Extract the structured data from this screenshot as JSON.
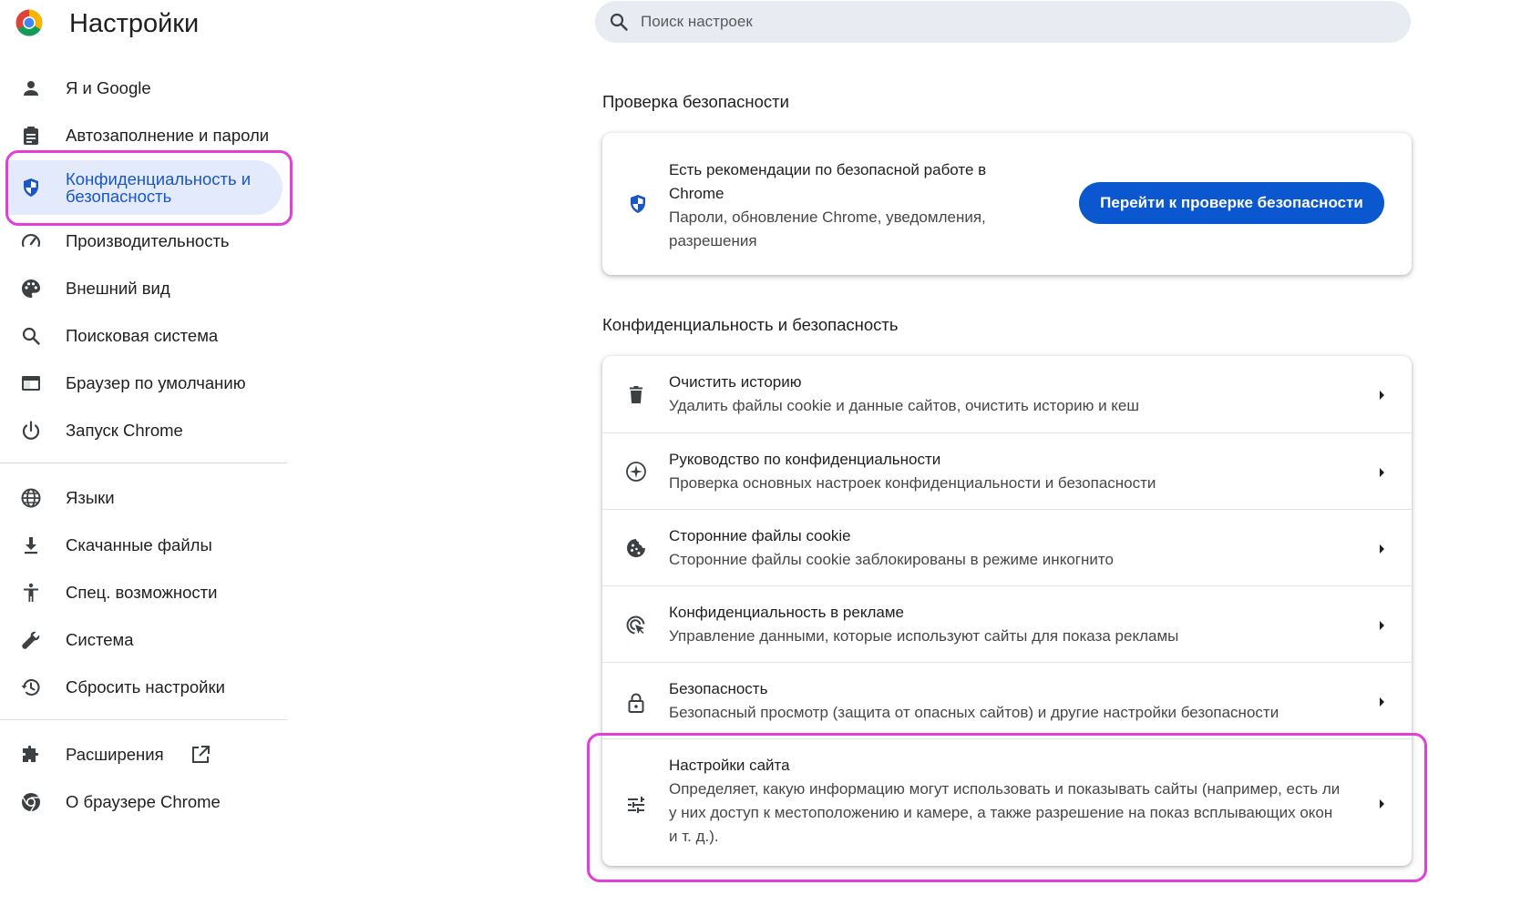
{
  "header": {
    "title": "Настройки",
    "search_placeholder": "Поиск настроек"
  },
  "sidebar": {
    "items": [
      {
        "label": "Я и Google",
        "icon": "person-icon"
      },
      {
        "label": "Автозаполнение и пароли",
        "icon": "clipboard-icon"
      },
      {
        "label": "Конфиденциальность и безопасность",
        "icon": "shield-icon",
        "active": true
      },
      {
        "label": "Производительность",
        "icon": "speedometer-icon"
      },
      {
        "label": "Внешний вид",
        "icon": "palette-icon"
      },
      {
        "label": "Поисковая система",
        "icon": "search-icon"
      },
      {
        "label": "Браузер по умолчанию",
        "icon": "browser-window-icon"
      },
      {
        "label": "Запуск Chrome",
        "icon": "power-icon"
      },
      {
        "label": "Языки",
        "icon": "globe-icon"
      },
      {
        "label": "Скачанные файлы",
        "icon": "download-icon"
      },
      {
        "label": "Спец. возможности",
        "icon": "accessibility-icon"
      },
      {
        "label": "Система",
        "icon": "wrench-icon"
      },
      {
        "label": "Сбросить настройки",
        "icon": "restore-icon"
      },
      {
        "label": "Расширения",
        "icon": "puzzle-icon",
        "external": true
      },
      {
        "label": "О браузере Chrome",
        "icon": "chrome-icon"
      }
    ]
  },
  "safety_check": {
    "section_title": "Проверка безопасности",
    "title": "Есть рекомендации по безопасной работе в Chrome",
    "subtitle": "Пароли, обновление Chrome, уведомления, разрешения",
    "button_label": "Перейти к проверке безопасности"
  },
  "privacy": {
    "section_title": "Конфиденциальность и безопасность",
    "rows": [
      {
        "title": "Очистить историю",
        "desc": "Удалить файлы cookie и данные сайтов, очистить историю и кеш",
        "icon": "trash-icon"
      },
      {
        "title": "Руководство по конфиденциальности",
        "desc": "Проверка основных настроек конфиденциальности и безопасности",
        "icon": "compass-icon"
      },
      {
        "title": "Сторонние файлы cookie",
        "desc": "Сторонние файлы cookie заблокированы в режиме инкогнито",
        "icon": "cookie-icon"
      },
      {
        "title": "Конфиденциальность в рекламе",
        "desc": "Управление данными, которые используют сайты для показа рекламы",
        "icon": "ad-privacy-icon"
      },
      {
        "title": "Безопасность",
        "desc": "Безопасный просмотр (защита от опасных сайтов) и другие настройки безопасности",
        "icon": "lock-icon"
      },
      {
        "title": "Настройки сайта",
        "desc": "Определяет, какую информацию могут использовать и показывать сайты (например, есть ли у них доступ к местоположению и камере, а также разрешение на показ всплывающих окон и т. д.).",
        "icon": "tune-icon"
      }
    ]
  },
  "colors": {
    "accent": "#0b57d0",
    "active_bg": "#e2eafc",
    "highlight": "#e040d8"
  }
}
